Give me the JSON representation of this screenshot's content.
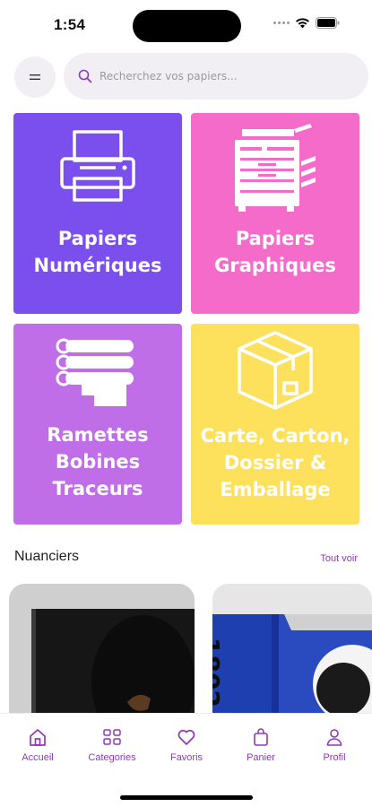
{
  "status_bar": {
    "time": "1:54"
  },
  "search": {
    "placeholder": "Recherchez vos papiers..."
  },
  "categories": [
    {
      "label": "Papiers\nNumériques",
      "color": "#7a4fee",
      "icon": "printer-icon"
    },
    {
      "label": "Papiers\nGraphiques",
      "color": "#f56bc9",
      "icon": "copier-icon"
    },
    {
      "label": "Ramettes\nBobines\nTraceurs",
      "color": "#c06ee7",
      "icon": "paper-rolls-icon"
    },
    {
      "label": "Carte, Carton,\nDossier &\nEmballage",
      "color": "#fde05b",
      "icon": "box-icon"
    }
  ],
  "nuanciers": {
    "title": "Nuanciers",
    "see_all": "Tout voir",
    "card2_text": "1802"
  },
  "nav": {
    "accent": "#8e3ab5",
    "items": [
      {
        "label": "Accueil",
        "icon": "home-icon"
      },
      {
        "label": "Categories",
        "icon": "grid-icon"
      },
      {
        "label": "Favoris",
        "icon": "heart-icon"
      },
      {
        "label": "Panier",
        "icon": "bag-icon"
      },
      {
        "label": "Profil",
        "icon": "user-icon"
      }
    ]
  }
}
